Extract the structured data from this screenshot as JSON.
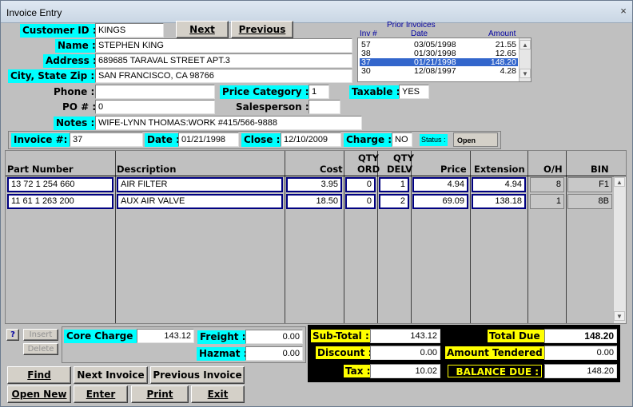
{
  "window": {
    "title": "Invoice Entry",
    "close": "×"
  },
  "customer": {
    "id_label": "Customer ID :",
    "id": "KINGS",
    "name_label": "Name :",
    "name": "STEPHEN KING",
    "address_label": "Address :",
    "address": "689685 TARAVAL STREET APT.3",
    "city_label": "City, State  Zip :",
    "city": "SAN FRANCISCO, CA  98766",
    "phone_label": "Phone :",
    "phone": "",
    "po_label": "PO # :",
    "po": "0",
    "notes_label": "Notes :",
    "notes": "WIFE-LYNN THOMAS:WORK #415/566-9888"
  },
  "nav": {
    "next": "Next",
    "previous": "Previous"
  },
  "prior_invoices": {
    "title": "Prior Invoices",
    "headers": {
      "inv": "Inv #",
      "date": "Date",
      "amount": "Amount"
    },
    "rows": [
      {
        "inv": "57",
        "date": "03/05/1998",
        "amount": "21.55",
        "selected": false
      },
      {
        "inv": "38",
        "date": "01/30/1998",
        "amount": "12.65",
        "selected": false
      },
      {
        "inv": "37",
        "date": "01/21/1998",
        "amount": "148.20",
        "selected": true
      },
      {
        "inv": "30",
        "date": "12/08/1997",
        "amount": "4.28",
        "selected": false
      }
    ]
  },
  "pricing": {
    "category_label": "Price Category :",
    "category": "1",
    "taxable_label": "Taxable :",
    "taxable": "YES",
    "salesperson_label": "Salesperson :",
    "salesperson": ""
  },
  "invoice": {
    "number_label": "Invoice #:",
    "number": "37",
    "date_label": "Date :",
    "date": "01/21/1998",
    "close_label": "Close :",
    "close": "12/10/2009",
    "charge_label": "Charge :",
    "charge": "NO",
    "status_label": "Status :",
    "status": "Open"
  },
  "columns": {
    "part": "Part Number",
    "desc": "Description",
    "cost": "Cost",
    "qty_ord_1": "QTY",
    "qty_ord_2": "ORD",
    "qty_delv_1": "QTY",
    "qty_delv_2": "DELV",
    "price": "Price",
    "extension": "Extension",
    "oh": "O/H",
    "bin": "BIN"
  },
  "lines": [
    {
      "part": "13 72 1 254 660",
      "desc": "AIR FILTER",
      "cost": "3.95",
      "ord": "0",
      "delv": "1",
      "price": "4.94",
      "ext": "4.94",
      "oh": "8",
      "bin": "F1"
    },
    {
      "part": "11 61 1 263 200",
      "desc": "AUX AIR VALVE",
      "cost": "18.50",
      "ord": "0",
      "delv": "2",
      "price": "69.09",
      "ext": "138.18",
      "oh": "1",
      "bin": "8B"
    }
  ],
  "side": {
    "help": "?",
    "insert": "Insert",
    "delete": "Delete"
  },
  "charges": {
    "core_label": "Core Charge :",
    "core": "143.12",
    "freight_label": "Freight :",
    "freight": "0.00",
    "hazmat_label": "Hazmat :",
    "hazmat": "0.00"
  },
  "totals": {
    "subtotal_label": "Sub-Total :",
    "subtotal": "143.12",
    "discount_label": "Discount :",
    "discount": "0.00",
    "tax_label": "Tax :",
    "tax": "10.02",
    "total_due_label": "Total Due :",
    "total_due": "148.20",
    "tendered_label": "Amount Tendered :",
    "tendered": "0.00",
    "balance_label": "BALANCE DUE :",
    "balance": "148.20"
  },
  "buttons": {
    "find": "Find",
    "next_invoice": "Next Invoice",
    "previous_invoice": "Previous Invoice",
    "open_new": "Open New",
    "enter": "Enter",
    "print": "Print",
    "exit": "Exit"
  },
  "colors": {
    "label_bg": "#00ffff",
    "totals_label_bg": "#ffff00",
    "selection": "#3366cc"
  }
}
